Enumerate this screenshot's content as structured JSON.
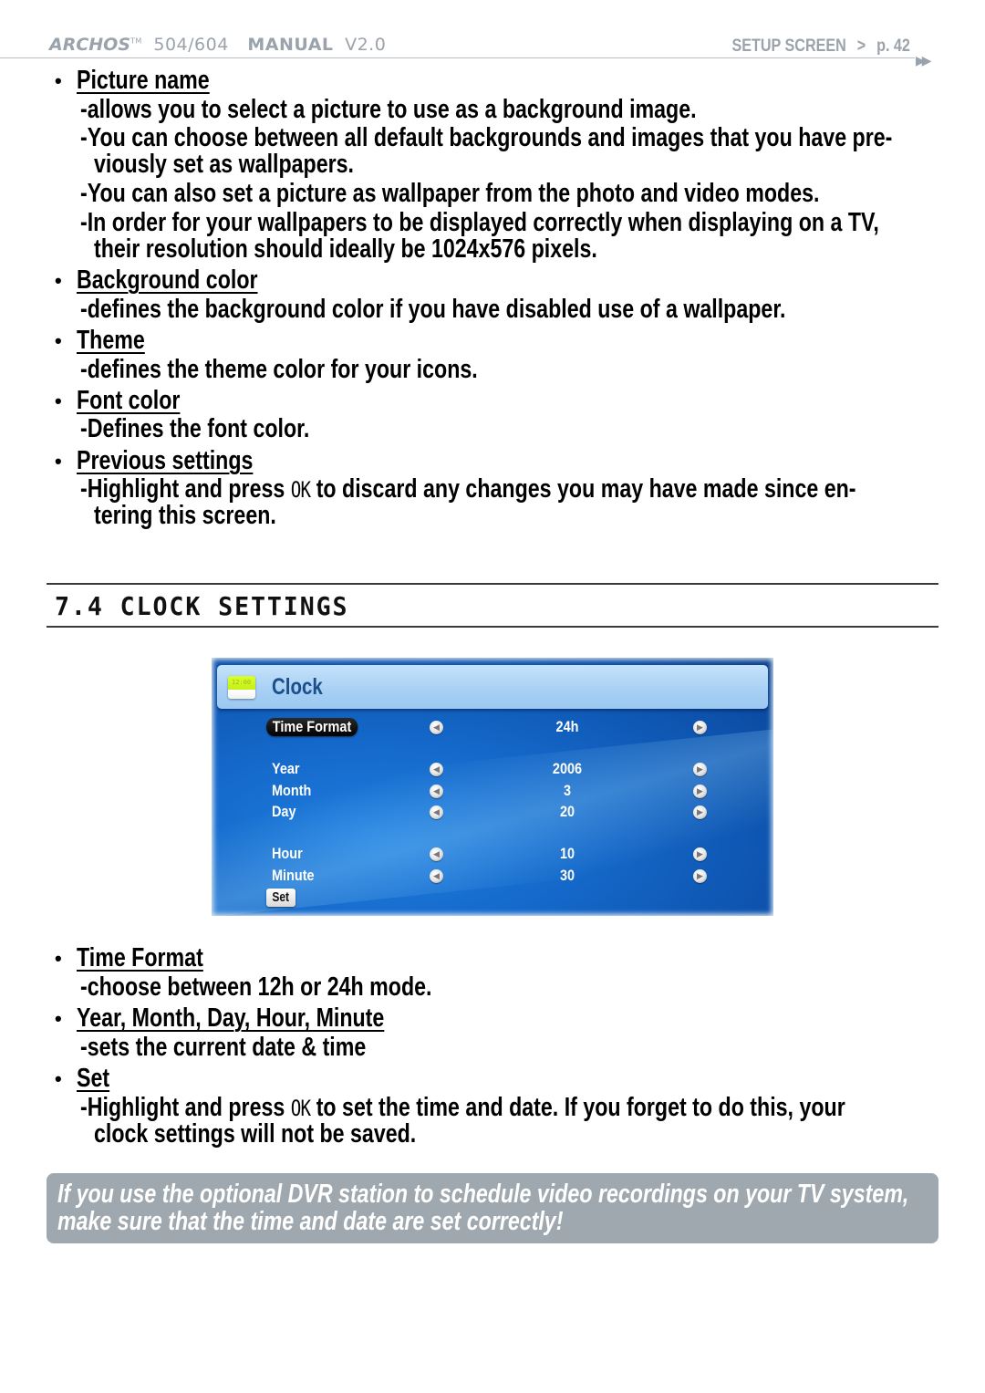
{
  "header": {
    "brand": "ARCHOS",
    "trademark": "TM",
    "model": "504/604",
    "manual_label": "MANUAL",
    "version": "V2.0",
    "section": "SETUP SCREEN",
    "separator": ">",
    "page": "p. 42",
    "next_icon": "next-page-icon"
  },
  "wallpaper_items": [
    {
      "title": "Picture name",
      "lines": [
        "allows you to select a picture to use as a background image.",
        "You can choose between all default backgrounds and images that you have pre-",
        "viously set as wallpapers.",
        "You can also set a picture as wallpaper from the photo and video modes.",
        "In order for your wallpapers to be displayed correctly when displaying on a TV,",
        "their resolution should ideally be 1024x576 pixels."
      ]
    },
    {
      "title": "Background color",
      "lines": [
        "defines the background color if you have disabled use of a wallpaper."
      ]
    },
    {
      "title": "Theme",
      "lines": [
        "defines the theme color for your icons."
      ]
    },
    {
      "title": "Font color",
      "lines": [
        "Defines the font color."
      ]
    },
    {
      "title": "Previous settings",
      "lines": [
        {
          "before": "Highlight and press ",
          "key": "OK",
          "after": " to discard any changes you may have made since en-"
        },
        "tering this screen."
      ]
    }
  ],
  "section": {
    "number": "7.4",
    "title": "CLOCK SETTINGS"
  },
  "clock_screen": {
    "title": "Clock",
    "icon": "clock-app-icon",
    "rows": [
      {
        "label": "Time Format",
        "value": "24h",
        "selected": true
      },
      {
        "label": "Year",
        "value": "2006"
      },
      {
        "label": "Month",
        "value": "3"
      },
      {
        "label": "Day",
        "value": "20"
      },
      {
        "label": "Hour",
        "value": "10"
      },
      {
        "label": "Minute",
        "value": "30"
      }
    ],
    "set_label": "Set",
    "colors": {
      "background": "#1467c8",
      "titlebar": "#a6cff4",
      "title_text": "#1b4e8a"
    }
  },
  "clock_items": [
    {
      "title": "Time Format",
      "lines": [
        "choose between 12h or 24h mode."
      ]
    },
    {
      "title": "Year, Month, Day, Hour, Minute",
      "lines": [
        "sets the current date & time"
      ]
    },
    {
      "title": "Set",
      "lines": [
        {
          "before": "Highlight and press ",
          "key": "OK",
          "after": " to set the time and date. If you forget to do this, your"
        },
        "clock settings will not be saved."
      ]
    }
  ],
  "note": {
    "lines": [
      "If you use the optional DVR station to schedule video recordings on your TV system,",
      "make sure that the time and date are set correctly!"
    ],
    "color": "#9ea8ae"
  }
}
